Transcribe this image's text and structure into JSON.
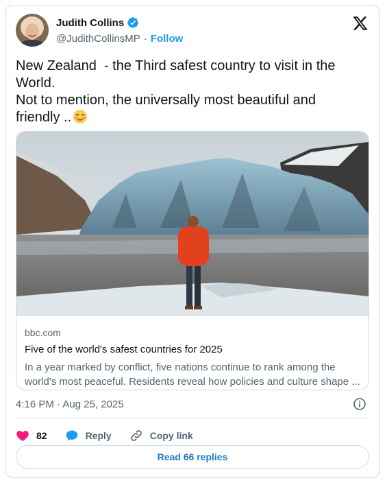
{
  "author": {
    "name": "Judith Collins",
    "handle": "@JudithCollinsMP",
    "separator": "·",
    "follow_label": "Follow"
  },
  "tweet": {
    "line1": "New Zealand  - the Third safest country to visit in the",
    "line2": "World.",
    "line3": "Not to mention, the universally most beautiful and",
    "line4": "friendly .."
  },
  "link_card": {
    "domain": "bbc.com",
    "title": "Five of the world's safest countries for 2025",
    "description_line1": "In a year marked by conflict, five nations continue to rank among the",
    "description_line2": "world's most peaceful. Residents reveal how policies and culture shape ..."
  },
  "timestamp": "4:16 PM · Aug 25, 2025",
  "actions": {
    "like_count": "82",
    "reply_label": "Reply",
    "copy_label": "Copy link"
  },
  "read_replies_label": "Read 66 replies",
  "colors": {
    "accent": "#1d9bf0",
    "like": "#f91880",
    "text": "#0f1419",
    "secondary": "#536471"
  },
  "icons": [
    "verified-badge-icon",
    "x-logo-icon",
    "smiling-face-emoji",
    "heart-icon",
    "reply-bubble-icon",
    "link-icon",
    "info-icon"
  ]
}
